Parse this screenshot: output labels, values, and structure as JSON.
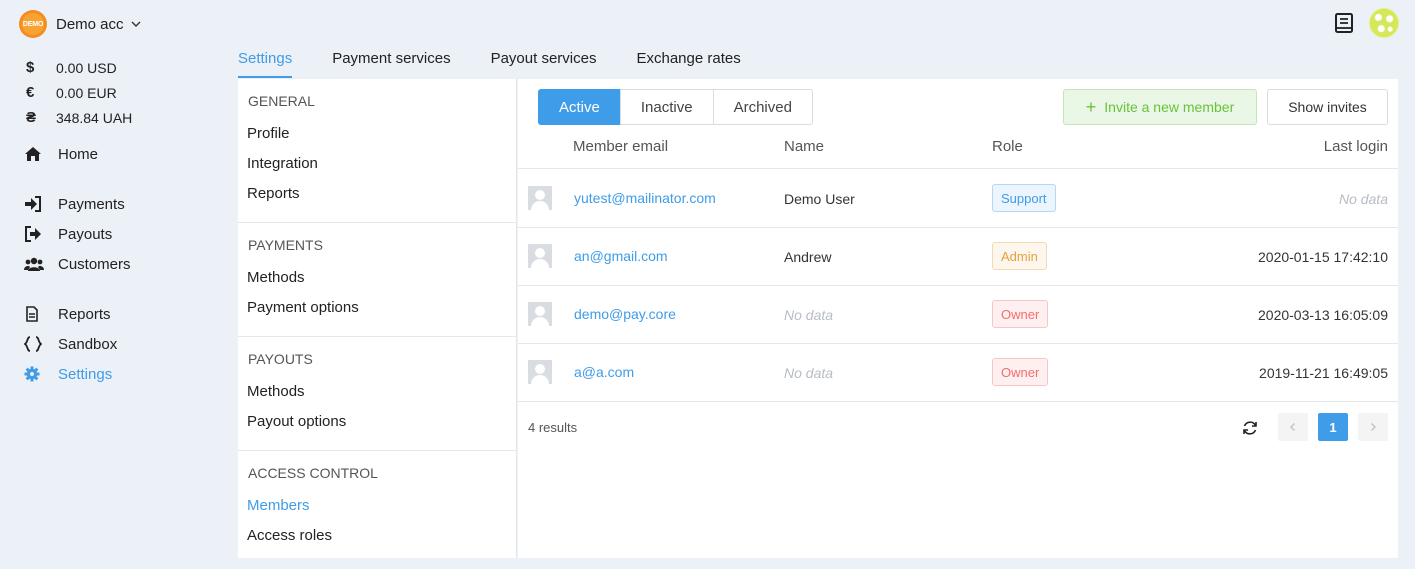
{
  "account": {
    "logo_text": "DEMO",
    "name": "Demo acc"
  },
  "balances": [
    {
      "symbol": "$",
      "amount": "0.00 USD"
    },
    {
      "symbol": "€",
      "amount": "0.00 EUR"
    },
    {
      "symbol": "₴",
      "amount": "348.84 UAH"
    }
  ],
  "nav": {
    "home": "Home",
    "payments": "Payments",
    "payouts": "Payouts",
    "customers": "Customers",
    "reports": "Reports",
    "sandbox": "Sandbox",
    "settings": "Settings"
  },
  "tabs": [
    "Settings",
    "Payment services",
    "Payout services",
    "Exchange rates"
  ],
  "submenu": {
    "general": {
      "title": "GENERAL",
      "items": [
        "Profile",
        "Integration",
        "Reports"
      ]
    },
    "payments": {
      "title": "PAYMENTS",
      "items": [
        "Methods",
        "Payment options"
      ]
    },
    "payouts": {
      "title": "PAYOUTS",
      "items": [
        "Methods",
        "Payout options"
      ]
    },
    "access": {
      "title": "ACCESS CONTROL",
      "items": [
        "Members",
        "Access roles"
      ]
    }
  },
  "filters": {
    "active": "Active",
    "inactive": "Inactive",
    "archived": "Archived"
  },
  "buttons": {
    "invite_plus": "+",
    "invite": "Invite a new member",
    "show_invites": "Show invites"
  },
  "table": {
    "headers": {
      "email": "Member email",
      "name": "Name",
      "role": "Role",
      "last_login": "Last login"
    },
    "rows": [
      {
        "email": "yutest@mailinator.com",
        "name": "Demo User",
        "role": "Support",
        "last_login": "No data"
      },
      {
        "email": "an@gmail.com",
        "name": "Andrew",
        "role": "Admin",
        "last_login": "2020-01-15 17:42:10"
      },
      {
        "email": "demo@pay.core",
        "name": "No data",
        "role": "Owner",
        "last_login": "2020-03-13 16:05:09"
      },
      {
        "email": "a@a.com",
        "name": "No data",
        "role": "Owner",
        "last_login": "2019-11-21 16:49:05"
      }
    ]
  },
  "pagination": {
    "results": "4 results",
    "current_page": "1"
  },
  "colors": {
    "accent": "#3f9ce8",
    "success": "#67c23a",
    "warning": "#e6a23c",
    "danger": "#f56c6c"
  }
}
